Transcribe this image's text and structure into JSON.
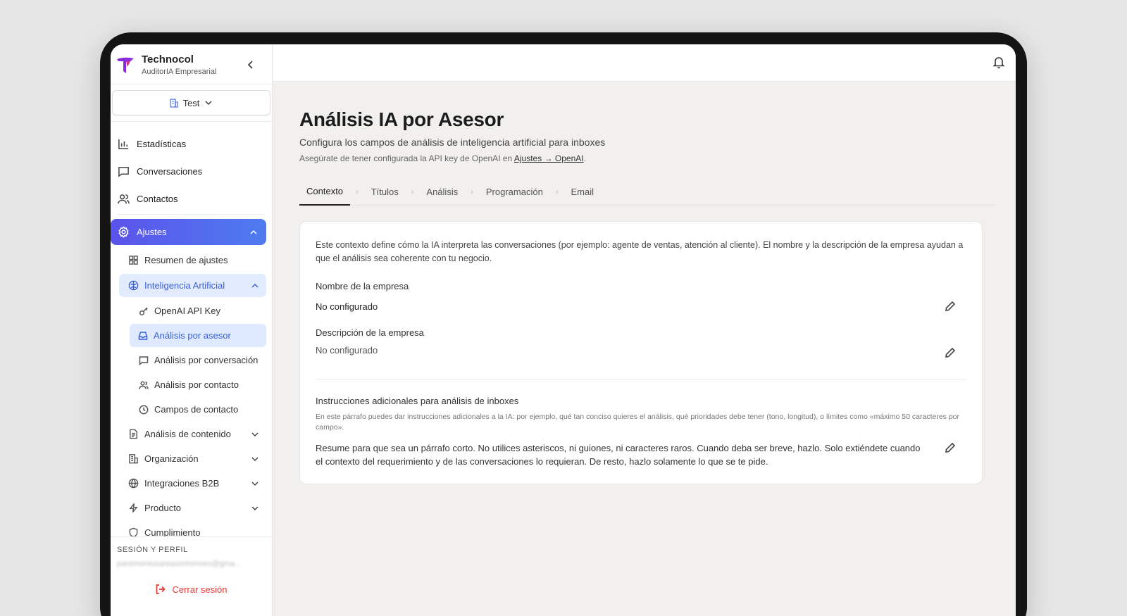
{
  "brand": {
    "name": "Technocol",
    "subtitle": "AuditorIA Empresarial"
  },
  "org_select": {
    "label": "Test"
  },
  "nav": {
    "items": [
      {
        "label": "Estadísticas",
        "icon": "chart-icon"
      },
      {
        "label": "Conversaciones",
        "icon": "message-icon"
      },
      {
        "label": "Contactos",
        "icon": "users-icon"
      }
    ],
    "settings": {
      "label": "Ajustes",
      "icon": "gear-icon"
    },
    "settings_sub": {
      "summary": "Resumen de ajustes",
      "ai": "Inteligencia Artificial",
      "ai_children": [
        {
          "label": "OpenAI API Key",
          "icon": "key-icon"
        },
        {
          "label": "Análisis por asesor",
          "icon": "inbox-icon"
        },
        {
          "label": "Análisis por conversación",
          "icon": "message-icon"
        },
        {
          "label": "Análisis por contacto",
          "icon": "users-icon"
        },
        {
          "label": "Campos de contacto",
          "icon": "clock-icon"
        }
      ],
      "content_analysis": "Análisis de contenido",
      "organization": "Organización",
      "integrations": "Integraciones B2B",
      "product": "Producto",
      "compliance": "Cumplimiento"
    }
  },
  "footer": {
    "section_label": "SESIÓN Y PERFIL",
    "email": "parsimoniusareasonhonses@gma...",
    "logout": "Cerrar sesión"
  },
  "page": {
    "title": "Análisis IA por Asesor",
    "subtitle": "Configura los campos de análisis de inteligencia artificial para inboxes",
    "note_prefix": "Asegúrate de tener configurada la API key de OpenAI en ",
    "note_link": "Ajustes → OpenAI",
    "note_suffix": "."
  },
  "tabs": [
    "Contexto",
    "Títulos",
    "Análisis",
    "Programación",
    "Email"
  ],
  "card": {
    "intro": "Este contexto define cómo la IA interpreta las conversaciones (por ejemplo: agente de ventas, atención al cliente). El nombre y la descripción de la empresa ayudan a que el análisis sea coherente con tu negocio.",
    "company_name_label": "Nombre de la empresa",
    "company_name_value": "No configurado",
    "company_desc_label": "Descripción de la empresa",
    "company_desc_value": "No configurado",
    "instructions_label": "Instrucciones adicionales para análisis de inboxes",
    "instructions_help": "En este párrafo puedes dar instrucciones adicionales a la IA: por ejemplo, qué tan conciso quieres el análisis, qué prioridades debe tener (tono, longitud), o límites como «máximo 50 caracteres por campo».",
    "instructions_value": "Resume para que sea un párrafo corto. No utilices asteriscos, ni guiones, ni caracteres raros. Cuando deba ser breve, hazlo. Solo extiéndete cuando el contexto del requerimiento y de las conversaciones lo requieran. De resto, hazlo solamente lo que se te pide."
  },
  "colors": {
    "accent_start": "#5b53ea",
    "accent_end": "#4e7cf0",
    "active_sub": "#3a5fd8",
    "logout": "#e53935",
    "logo": "#8a2be2"
  }
}
